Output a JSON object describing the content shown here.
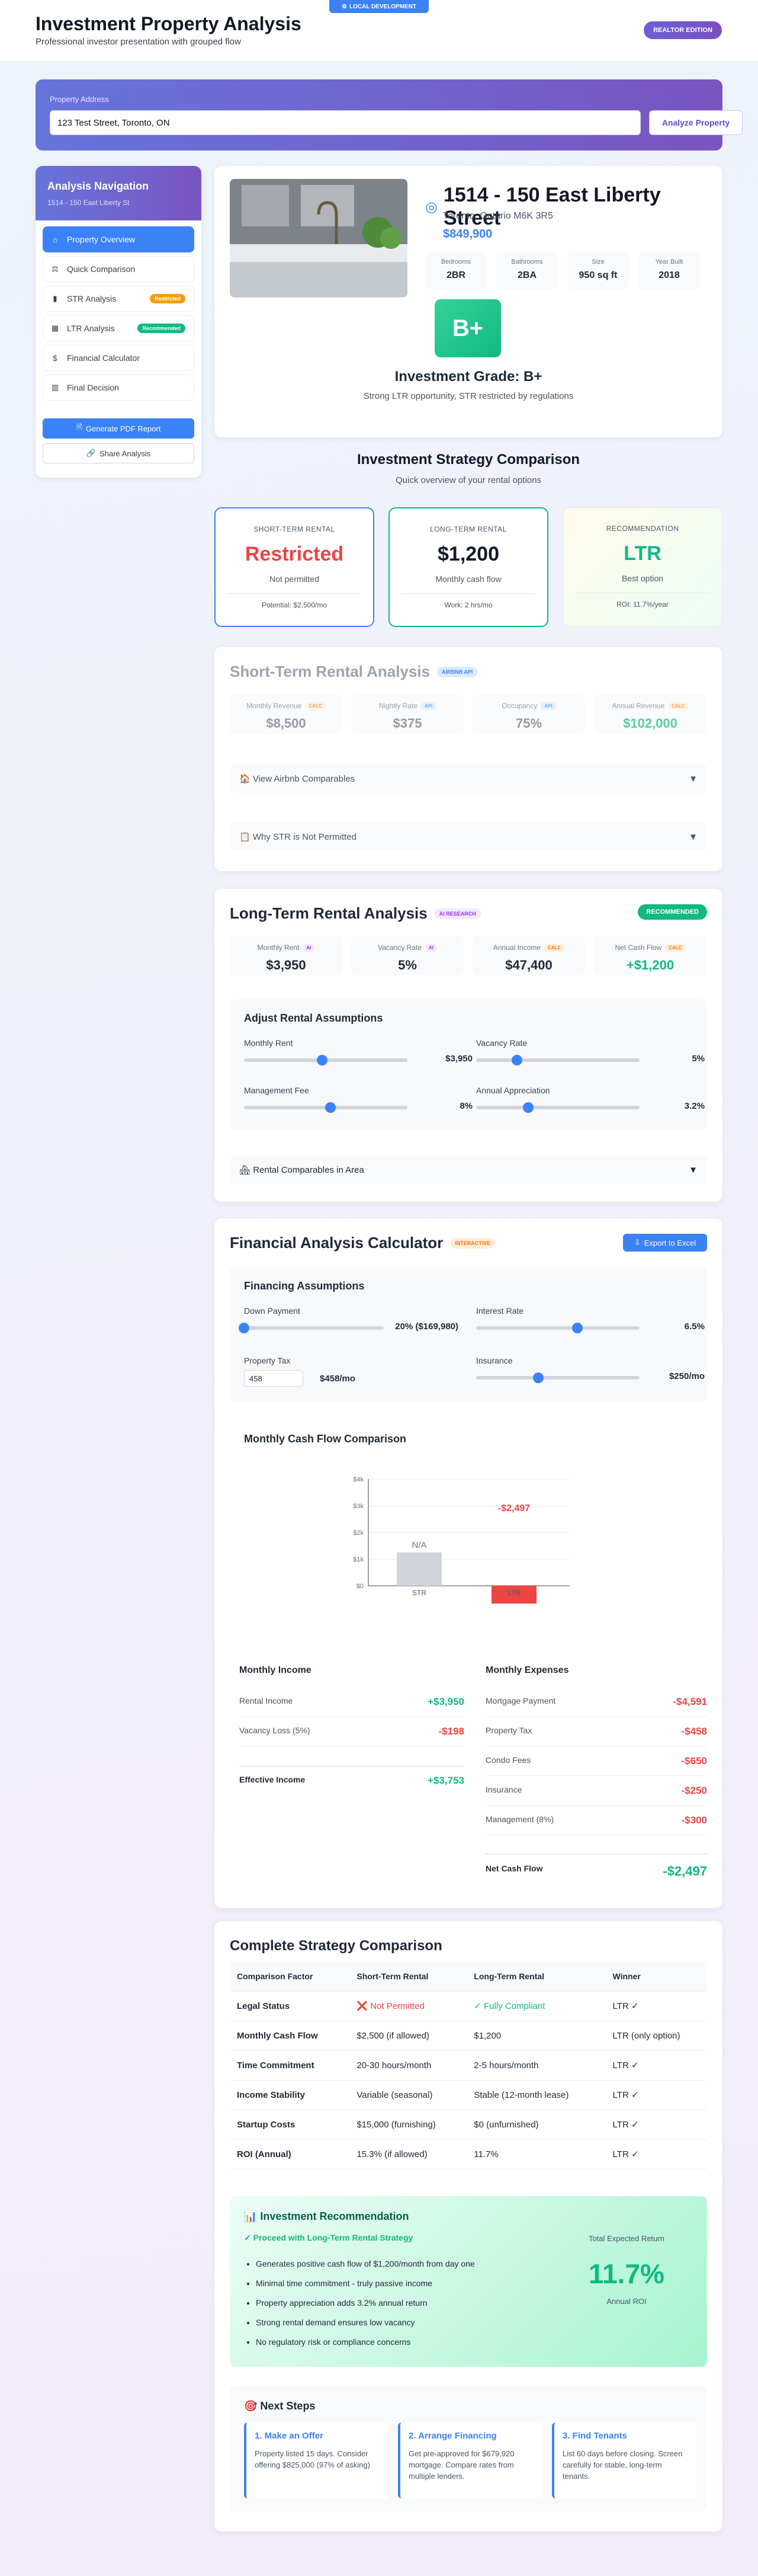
{
  "header": {
    "title": "Investment Property Analysis",
    "subtitle": "Professional investor presentation with grouped flow",
    "dev_badge": "LOCAL DEVELOPMENT",
    "realtor": "REALTOR EDITION"
  },
  "search": {
    "label": "Property Address",
    "value": "123 Test Street, Toronto, ON",
    "button": "Analyze Property"
  },
  "nav": {
    "title": "Analysis Navigation",
    "subtitle": "1514 - 150 East Liberty St",
    "items": [
      {
        "label": "Property Overview",
        "icon": "home-icon"
      },
      {
        "label": "Quick Comparison",
        "icon": "scale-icon"
      },
      {
        "label": "STR Analysis",
        "icon": "bar-chart-icon",
        "badge": "Restricted"
      },
      {
        "label": "LTR Analysis",
        "icon": "building-icon",
        "badge": "Recommended"
      },
      {
        "label": "Financial Calculator",
        "icon": "dollar-icon"
      },
      {
        "label": "Final Decision",
        "icon": "columns-icon"
      }
    ],
    "pdf": "Generate PDF Report",
    "share": "Share Analysis"
  },
  "property": {
    "address": "1514 - 150 East Liberty Street",
    "city": "Toronto, Ontario M6K 3R5",
    "price": "$849,900",
    "stats": [
      {
        "l": "Bedrooms",
        "v": "2BR"
      },
      {
        "l": "Bathrooms",
        "v": "2BA"
      },
      {
        "l": "Size",
        "v": "950 sq ft"
      },
      {
        "l": "Year Built",
        "v": "2018"
      }
    ],
    "grade": "B+",
    "grade_title": "Investment Grade: B+",
    "grade_sub": "Strong LTR opportunity, STR restricted by regulations"
  },
  "strategy": {
    "title": "Investment Strategy Comparison",
    "subtitle": "Quick overview of your rental options",
    "cards": [
      {
        "lab": "SHORT-TERM RENTAL",
        "big": "Restricted",
        "mid": "Not permitted",
        "foot": "Potential: $2,500/mo"
      },
      {
        "lab": "LONG-TERM RENTAL",
        "big": "$1,200",
        "mid": "Monthly cash flow",
        "foot": "Work: 2 hrs/mo"
      },
      {
        "lab": "RECOMMENDATION",
        "big": "LTR",
        "mid": "Best option",
        "foot": "ROI: 11.7%/year"
      }
    ]
  },
  "str": {
    "title": "Short-Term Rental Analysis",
    "tag": "AIRBNB API",
    "metrics": [
      {
        "l": "Monthly Revenue",
        "t": "CALC",
        "v": "$8,500"
      },
      {
        "l": "Nightly Rate",
        "t": "API",
        "v": "$375"
      },
      {
        "l": "Occupancy",
        "t": "API",
        "v": "75%"
      },
      {
        "l": "Annual Revenue",
        "t": "CALC",
        "v": "$102,000"
      }
    ],
    "acc1": "🏠 View Airbnb Comparables",
    "acc2": "📋 Why STR is Not Permitted"
  },
  "ltr": {
    "title": "Long-Term Rental Analysis",
    "tag": "AI RESEARCH",
    "rec": "RECOMMENDED",
    "metrics": [
      {
        "l": "Monthly Rent",
        "t": "AI",
        "v": "$3,950"
      },
      {
        "l": "Vacancy Rate",
        "t": "AI",
        "v": "5%"
      },
      {
        "l": "Annual Income",
        "t": "CALC",
        "v": "$47,400"
      },
      {
        "l": "Net Cash Flow",
        "t": "CALC",
        "v": "+$1,200"
      }
    ],
    "panel": "Adjust Rental Assumptions",
    "sliders": [
      {
        "l": "Monthly Rent",
        "v": "$3,950",
        "p": 0.48
      },
      {
        "l": "Vacancy Rate",
        "v": "5%",
        "p": 0.25
      },
      {
        "l": "Management Fee",
        "v": "8%",
        "p": 0.53
      },
      {
        "l": "Annual Appreciation",
        "v": "3.2%",
        "p": 0.32
      }
    ],
    "acc": "🏘 Rental Comparables in Area"
  },
  "fin": {
    "title": "Financial Analysis Calculator",
    "tag": "INTERACTIVE",
    "export": "Export to Excel",
    "panel": "Financing Assumptions",
    "down": {
      "l": "Down Payment",
      "v": "20% ($169,980)",
      "p": 0.0
    },
    "rate": {
      "l": "Interest Rate",
      "v": "6.5%",
      "p": 0.62
    },
    "tax": {
      "l": "Property Tax",
      "input": "458",
      "v": "$458/mo"
    },
    "ins": {
      "l": "Insurance",
      "v": "$250/mo",
      "p": 0.38
    },
    "chart_title": "Monthly Cash Flow Comparison",
    "income_title": "Monthly Income",
    "expense_title": "Monthly Expenses",
    "income": [
      {
        "l": "Rental Income",
        "v": "+$3,950"
      },
      {
        "l": "Vacancy Loss (5%)",
        "v": "-$198"
      }
    ],
    "effective": {
      "l": "Effective Income",
      "v": "+$3,753"
    },
    "expenses": [
      {
        "l": "Mortgage Payment",
        "v": "-$4,591"
      },
      {
        "l": "Property Tax",
        "v": "-$458"
      },
      {
        "l": "Condo Fees",
        "v": "-$650"
      },
      {
        "l": "Insurance",
        "v": "-$250"
      },
      {
        "l": "Management (8%)",
        "v": "-$300"
      }
    ],
    "net": {
      "l": "Net Cash Flow",
      "v": "-$2,497"
    }
  },
  "chart_data": {
    "type": "bar",
    "categories": [
      "STR",
      "LTR"
    ],
    "values": [
      null,
      -2497
    ],
    "labels": [
      "N/A",
      "-$2,497"
    ],
    "yticks": [
      "$4k",
      "$3k",
      "$2k",
      "$1k",
      "$0"
    ],
    "ylim": [
      -1000,
      4000
    ]
  },
  "compare": {
    "title": "Complete Strategy Comparison",
    "headers": [
      "Comparison Factor",
      "Short-Term Rental",
      "Long-Term Rental",
      "Winner"
    ],
    "rows": [
      [
        "Legal Status",
        "❌ Not Permitted",
        "✓ Fully Compliant",
        "LTR ✓"
      ],
      [
        "Monthly Cash Flow",
        "$2,500 (if allowed)",
        "$1,200",
        "LTR (only option)"
      ],
      [
        "Time Commitment",
        "20-30 hours/month",
        "2-5 hours/month",
        "LTR ✓"
      ],
      [
        "Income Stability",
        "Variable (seasonal)",
        "Stable (12-month lease)",
        "LTR ✓"
      ],
      [
        "Startup Costs",
        "$15,000 (furnishing)",
        "$0 (unfurnished)",
        "LTR ✓"
      ],
      [
        "ROI (Annual)",
        "15.3% (if allowed)",
        "11.7%",
        "LTR ✓"
      ]
    ]
  },
  "rec": {
    "title": "📊 Investment Recommendation",
    "sub": "✓ Proceed with Long-Term Rental Strategy",
    "bullets": [
      "Generates positive cash flow of $1,200/month from day one",
      "Minimal time commitment - truly passive income",
      "Property appreciation adds 3.2% annual return",
      "Strong rental demand ensures low vacancy",
      "No regulatory risk or compliance concerns"
    ],
    "ret_label": "Total Expected Return",
    "ret": "11.7%",
    "ret_sub": "Annual ROI"
  },
  "next": {
    "title": "🎯 Next Steps",
    "steps": [
      {
        "t": "1. Make an Offer",
        "d": "Property listed 15 days. Consider offering $825,000 (97% of asking)"
      },
      {
        "t": "2. Arrange Financing",
        "d": "Get pre-approved for $679,920 mortgage. Compare rates from multiple lenders."
      },
      {
        "t": "3. Find Tenants",
        "d": "List 60 days before closing. Screen carefully for stable, long-term tenants."
      }
    ]
  },
  "colors": {
    "accent": "#3b82f6",
    "red": "#ef4444",
    "green": "#10b981"
  }
}
